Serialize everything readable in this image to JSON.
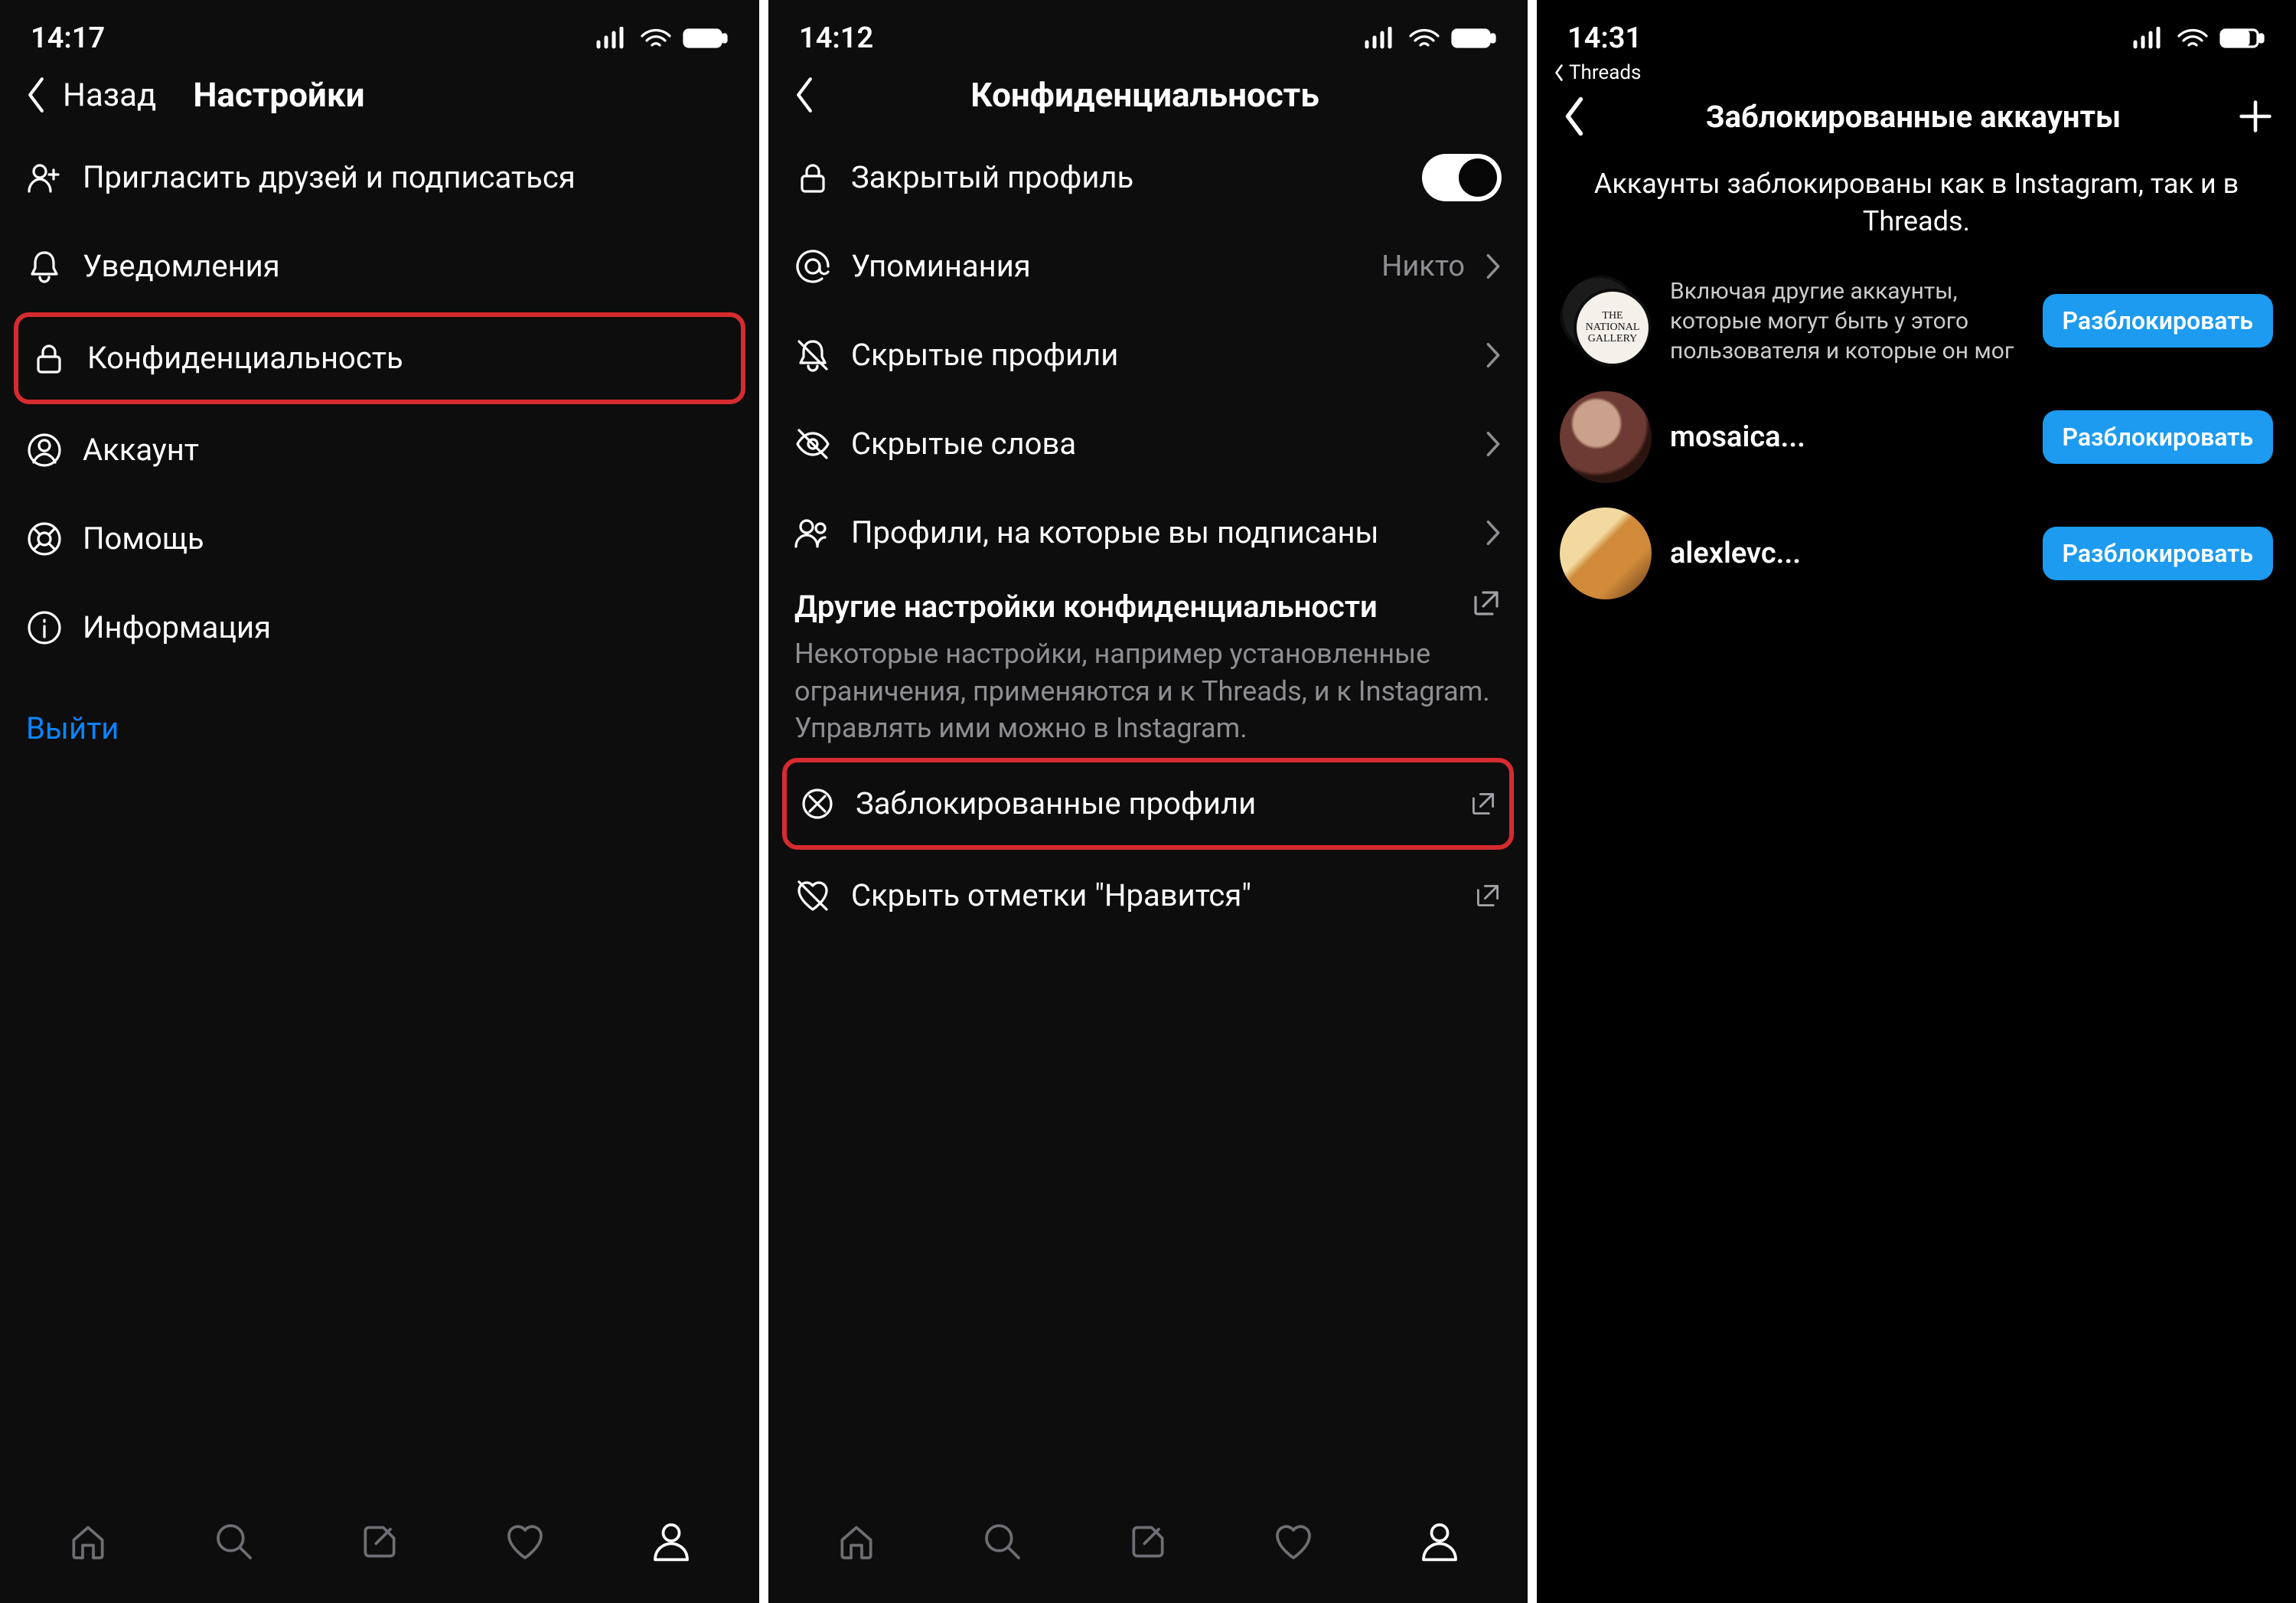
{
  "screen1": {
    "time": "14:17",
    "back_label": "Назад",
    "title": "Настройки",
    "rows": {
      "invite": "Пригласить друзей и подписаться",
      "notifications": "Уведомления",
      "privacy": "Конфиденциальность",
      "account": "Аккаунт",
      "help": "Помощь",
      "info": "Информация",
      "logout": "Выйти"
    }
  },
  "screen2": {
    "time": "14:12",
    "title": "Конфиденциальность",
    "rows": {
      "private_profile": "Закрытый профиль",
      "mentions": "Упоминания",
      "mentions_value": "Никто",
      "hidden_profiles": "Скрытые профили",
      "hidden_words": "Скрытые слова",
      "following": "Профили, на которые вы подписаны"
    },
    "section": {
      "title": "Другие настройки конфиденциальности",
      "desc": "Некоторые настройки, например установленные ограничения, применяются и к Threads, и к Instagram. Управлять ими можно в Instagram.",
      "blocked": "Заблокированные профили",
      "hide_likes": "Скрыть отметки \"Нравится\""
    }
  },
  "screen3": {
    "time": "14:31",
    "breadcrumb_app": "Threads",
    "title": "Заблокированные аккаунты",
    "desc": "Аккаунты заблокированы как в Instagram, так и в Threads.",
    "accounts": [
      {
        "name": "",
        "sub": "Включая другие аккаунты, которые могут быть у этого пользователя и которые он мог",
        "avatar_label": "THE NATIONAL GALLERY"
      },
      {
        "name": "mosaica...",
        "sub": ""
      },
      {
        "name": "alexlevc...",
        "sub": ""
      }
    ],
    "unblock_label": "Разблокировать"
  }
}
